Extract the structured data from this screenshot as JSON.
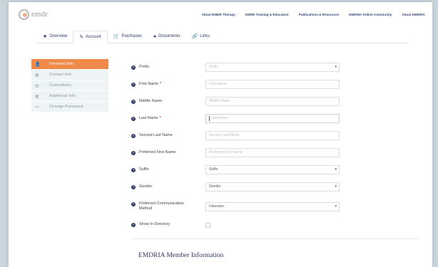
{
  "brand": {
    "logo_text": "emdr",
    "logo_sub": ""
  },
  "topnav": [
    "About EMDR Therapy",
    "EMDR Training & Education",
    "Publications & Resources",
    "EMDRIA Online Community",
    "About EMDRIA"
  ],
  "tabs": [
    {
      "label": "Overview",
      "icon": "star-icon",
      "glyph": "★"
    },
    {
      "label": "Account",
      "icon": "edit-icon",
      "glyph": "✎"
    },
    {
      "label": "Purchases",
      "icon": "cart-icon",
      "glyph": "🛒"
    },
    {
      "label": "Documents",
      "icon": "document-icon",
      "glyph": "●"
    },
    {
      "label": "Links",
      "icon": "link-icon",
      "glyph": "🔗"
    }
  ],
  "active_tab": "Account",
  "sidebar": [
    {
      "label": "Personal Info",
      "icon": "person-icon",
      "glyph": "👤",
      "active": true
    },
    {
      "label": "Contact Info",
      "icon": "contact-icon",
      "glyph": "▦",
      "active": false
    },
    {
      "label": "Committees",
      "icon": "committees-icon",
      "glyph": "▤",
      "active": false
    },
    {
      "label": "Additional Info",
      "icon": "info-icon",
      "glyph": "▦",
      "active": false
    },
    {
      "label": "Change Password",
      "icon": "key-icon",
      "glyph": "⊶",
      "active": false
    }
  ],
  "form": {
    "prefix": {
      "label": "Prefix",
      "value": "Prefix"
    },
    "first_name": {
      "label": "First Name",
      "required": "*",
      "placeholder": "First Name"
    },
    "middle_name": {
      "label": "Middle Name",
      "placeholder": "Middle Name"
    },
    "last_name": {
      "label": "Last Name",
      "required": "*",
      "placeholder": "Last Name"
    },
    "second_last_name": {
      "label": "Second Last Name",
      "placeholder": "Second Last Name"
    },
    "preferred_first_name": {
      "label": "Preferred First Name",
      "placeholder": "Preferred First Name"
    },
    "suffix": {
      "label": "Suffix",
      "value": "Suffix"
    },
    "gender": {
      "label": "Gender",
      "value": "Gender"
    },
    "preferred_comm": {
      "label": "Preferred Communication Method",
      "value": "Unknown"
    },
    "show_directory": {
      "label": "Show In Directory"
    }
  },
  "section_title": "EMDRIA Member Information",
  "colors": {
    "accent": "#f08a4b",
    "navy": "#2d3a66",
    "sidebar_bg": "#eef3f6",
    "required": "#e0442b"
  }
}
